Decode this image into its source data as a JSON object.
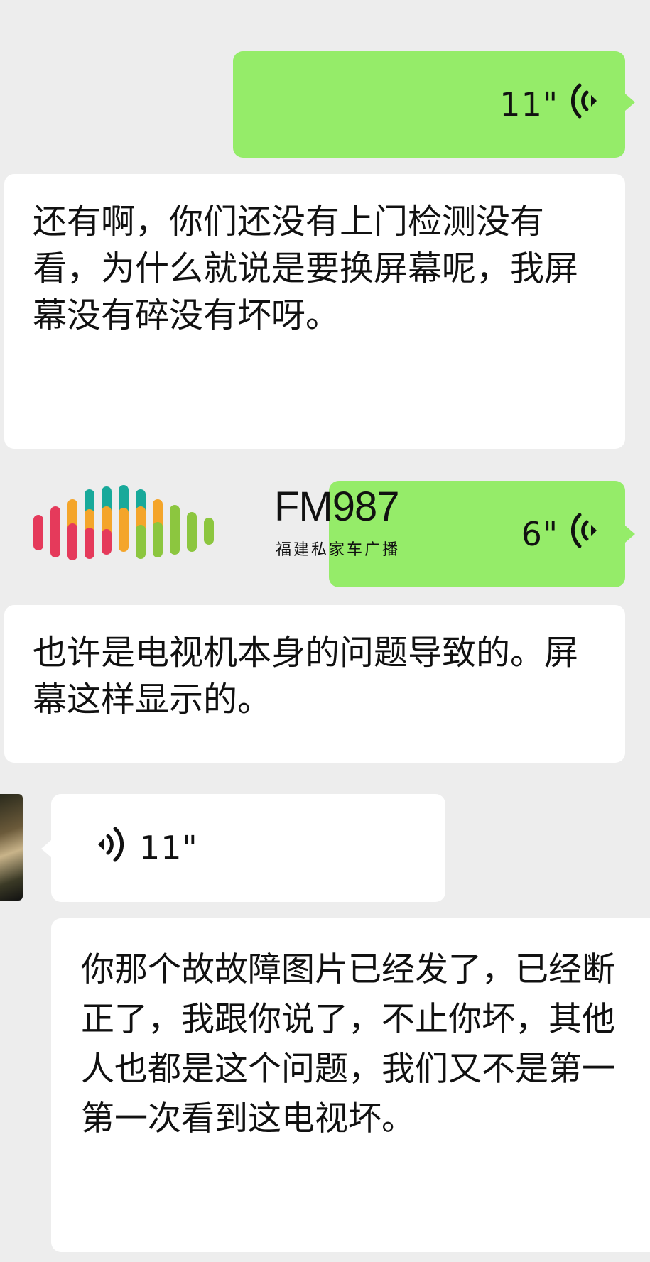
{
  "messages": [
    {
      "id": "m1",
      "side": "right",
      "type": "voice",
      "duration": "11\""
    },
    {
      "id": "m2",
      "side": "left",
      "type": "text",
      "text": "还有啊，你们还没有上门检测没有看，为什么就说是要换屏幕呢，我屏幕没有碎没有坏呀。"
    },
    {
      "id": "m3",
      "side": "right",
      "type": "voice",
      "duration": "6\""
    },
    {
      "id": "m4",
      "side": "left",
      "type": "text",
      "text": "也许是电视机本身的问题导致的。屏幕这样显示的。"
    },
    {
      "id": "m5",
      "side": "left",
      "type": "voice",
      "duration": "11\""
    },
    {
      "id": "m6",
      "side": "left",
      "type": "text",
      "text": "你那个故故障图片已经发了，已经断正了，我跟你说了，不止你坏，其他人也都是这个问题，我们又不是第一第一次看到这电视坏。"
    }
  ],
  "watermark": {
    "title": "FM987",
    "subtitle": "福建私家车广播",
    "colors": [
      "#e53a5b",
      "#f4a52a",
      "#18a99a",
      "#8cc63f"
    ]
  },
  "icons": {
    "voice_out": "voice-wave-icon-right",
    "voice_in": "voice-wave-icon-left",
    "avatar": "avatar"
  },
  "colors": {
    "background": "#ededed",
    "outgoing_bubble": "#95ec69",
    "incoming_bubble": "#ffffff"
  }
}
